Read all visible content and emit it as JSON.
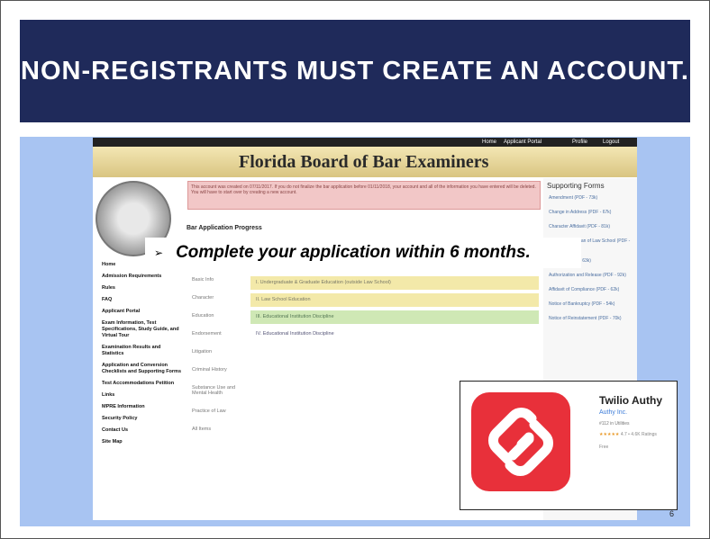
{
  "slide": {
    "title": "NON-REGISTRANTS MUST CREATE AN ACCOUNT.",
    "bullet_symbol": "➢",
    "bullet_text": "Complete your application within 6 months.",
    "page_number": "6"
  },
  "site": {
    "topnav": [
      "Home",
      "Applicant Portal",
      "Profile",
      "Logout"
    ],
    "banner_title": "Florida Board of Bar Examiners",
    "alert_text": "This account was created on 07/11/2017. If you do not finalize the bar application before 01/11/2018, your account and all of the information you have entered will be deleted. You will have to start over by creating a new account.",
    "progress_title": "Bar Application Progress",
    "left_nav": [
      "Home",
      "Admission Requirements",
      "Rules",
      "FAQ",
      "Applicant Portal",
      "Exam Information, Test Specifications, Study Guide, and Virtual Tour",
      "Examination Results and Statistics",
      "Application and Conversion Checklists and Supporting Forms",
      "Test Accommodations Petition",
      "Links",
      "MPRE Information",
      "Security Policy",
      "Contact Us",
      "Site Map"
    ],
    "sub_nav": [
      "Basic Info",
      "Character",
      "Education",
      "Endorsement",
      "Litigation",
      "Criminal History",
      "Substance Use and Mental Health",
      "Practice of Law",
      "All Items"
    ],
    "steps": [
      "I. Undergraduate & Graduate Education (outside Law School)",
      "II. Law School Education",
      "III. Educational Institution Discipline",
      "IV. Educational Institution Discipline"
    ],
    "supporting_forms_title": "Supporting Forms",
    "supporting_forms": [
      "Amendment (PDF - 73k)",
      "Change in Address (PDF - 67k)",
      "Character Affidavit (PDF - 81k)",
      "Certificate of Dean of Law School (PDF - 77k)",
      "Bill Form (PDF - 63k)",
      "Authorization and Release (PDF - 92k)",
      "Affidavit of Compliance (PDF - 62k)",
      "Notice of Bankruptcy (PDF - 54k)",
      "Notice of Reinstatement (PDF - 70k)"
    ]
  },
  "app_card": {
    "name": "Twilio Authy",
    "developer": "Authy Inc.",
    "meta": "#112 in Utilities",
    "stars": "★★★★★",
    "ratings": "4.7 • 4.6K Ratings",
    "get_label": "Free",
    "icon_color": "#e8303a"
  },
  "colors": {
    "title_bar": "#1f2a5a",
    "blue_area": "#a8c4f2"
  }
}
